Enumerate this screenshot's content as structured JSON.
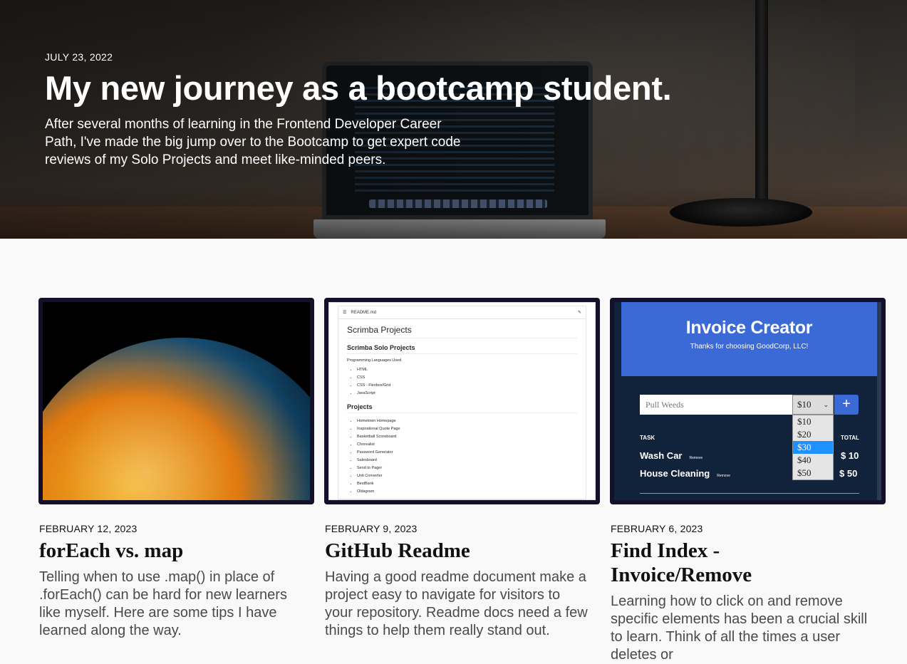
{
  "hero": {
    "date": "JULY 23, 2022",
    "title": "My new journey as a bootcamp student.",
    "description": "After several months of learning in the Frontend Developer Career Path, I've made the big jump over to the Bootcamp to get expert code reviews of my Solo Projects and meet like-minded peers."
  },
  "posts": [
    {
      "date": "FEBRUARY 12, 2023",
      "title": "forEach vs. map",
      "description": "Telling when to use .map() in place of .forEach() can be hard for new learners like myself. Here are some tips I have learned along the way."
    },
    {
      "date": "FEBRUARY 9, 2023",
      "title": "GitHub Readme",
      "description": "Having a good readme document make a project easy to navigate for visitors to your repository. Readme docs need a few things to help them really stand out."
    },
    {
      "date": "FEBRUARY 6, 2023",
      "title": "Find Index - Invoice/Remove",
      "description": "Learning how to click on and remove specific elements has been a crucial skill to learn. Think of all the times a user deletes or"
    }
  ],
  "readme_thumb": {
    "file": "README.md",
    "h1": "Scrimba Projects",
    "h2a": "Scrimba Solo Projects",
    "p": "Programming Languages Used",
    "langs": [
      "HTML",
      "CSS",
      "CSS - Flexbox/Grid",
      "JavaScript"
    ],
    "h2b": "Projects",
    "projects": [
      "Hometown Homepage",
      "Inspirational Quote Page",
      "Basketball Scoreboard",
      "Chorealist",
      "Password Generator",
      "Salesboard",
      "Send to Pager",
      "Unit Converter",
      "BestBank",
      "Oldagram"
    ]
  },
  "invoice_thumb": {
    "title": "Invoice Creator",
    "subtitle": "Thanks for choosing GoodCorp, LLC!",
    "input_value": "Pull Weeds",
    "select_value": "$10",
    "add_label": "+",
    "options": [
      "$10",
      "$20",
      "$30",
      "$40",
      "$50"
    ],
    "selected_option": "$30",
    "task_header": "TASK",
    "total_header": "TOTAL",
    "rows": [
      {
        "task": "Wash Car",
        "remove": "Remove",
        "amount": "$ 10"
      },
      {
        "task": "House Cleaning",
        "remove": "Remove",
        "amount": "$ 50"
      }
    ]
  }
}
